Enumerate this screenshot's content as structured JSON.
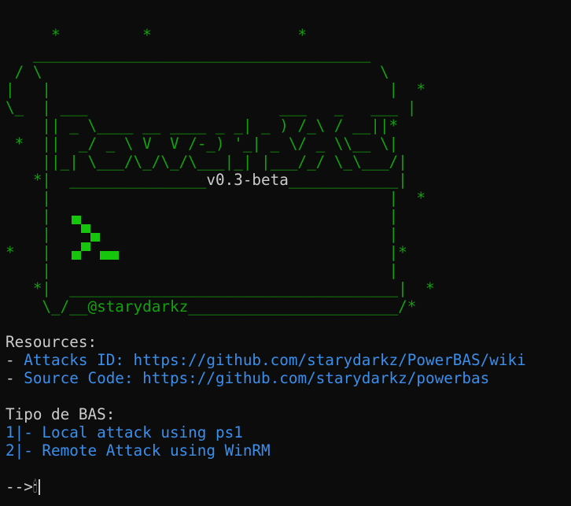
{
  "banner": {
    "art_lines": [
      "     *         *                *",
      "   _____________________________________",
      " / \\                                     \\",
      "|   |                                     |  *",
      "\\_  | ___                     ___   _   ___ |",
      "    || _ \\____ __ ____ _ _| _ ) /_\\ / __||*",
      " *  ||  _/ _ \\ V  V /-_) '_| _ \\/ _ \\\\__ \\|",
      "    ||_| \\___/\\_/\\_/\\___|_| |___/_/ \\_\\___/|",
      "   *|  _______________",
      "    |                                     |  *",
      "    |                                     |",
      "    |                                     |",
      "    |                                     |",
      "*   |                                     |*",
      "    |                                     |",
      "   *|  ____________________________________|  *",
      "    \\_/__",
      "",
      ""
    ],
    "version": "v0.3-beta",
    "version_tail": "____________|",
    "author": "@starydarkz",
    "author_tail": "_______________________/*"
  },
  "resources": {
    "heading": "Resources:",
    "items": [
      {
        "prefix": "- ",
        "label": "Attacks ID: https://github.com/starydarkz/PowerBAS/wiki"
      },
      {
        "prefix": "- ",
        "label": "Source Code: https://github.com/starydarkz/powerbas"
      }
    ]
  },
  "menu": {
    "heading": "Tipo de BAS:",
    "options": [
      {
        "label": "1|- Local attack using ps1"
      },
      {
        "label": "2|- Remote Attack using WinRM"
      }
    ]
  },
  "prompt": {
    "arrow": "-->",
    "emoji": "🕯"
  },
  "colors": {
    "background": "#0c0c0c",
    "art_green": "#13a10e",
    "logo_green": "#16c60c",
    "text": "#cccccc",
    "link_blue": "#3b8eea"
  }
}
